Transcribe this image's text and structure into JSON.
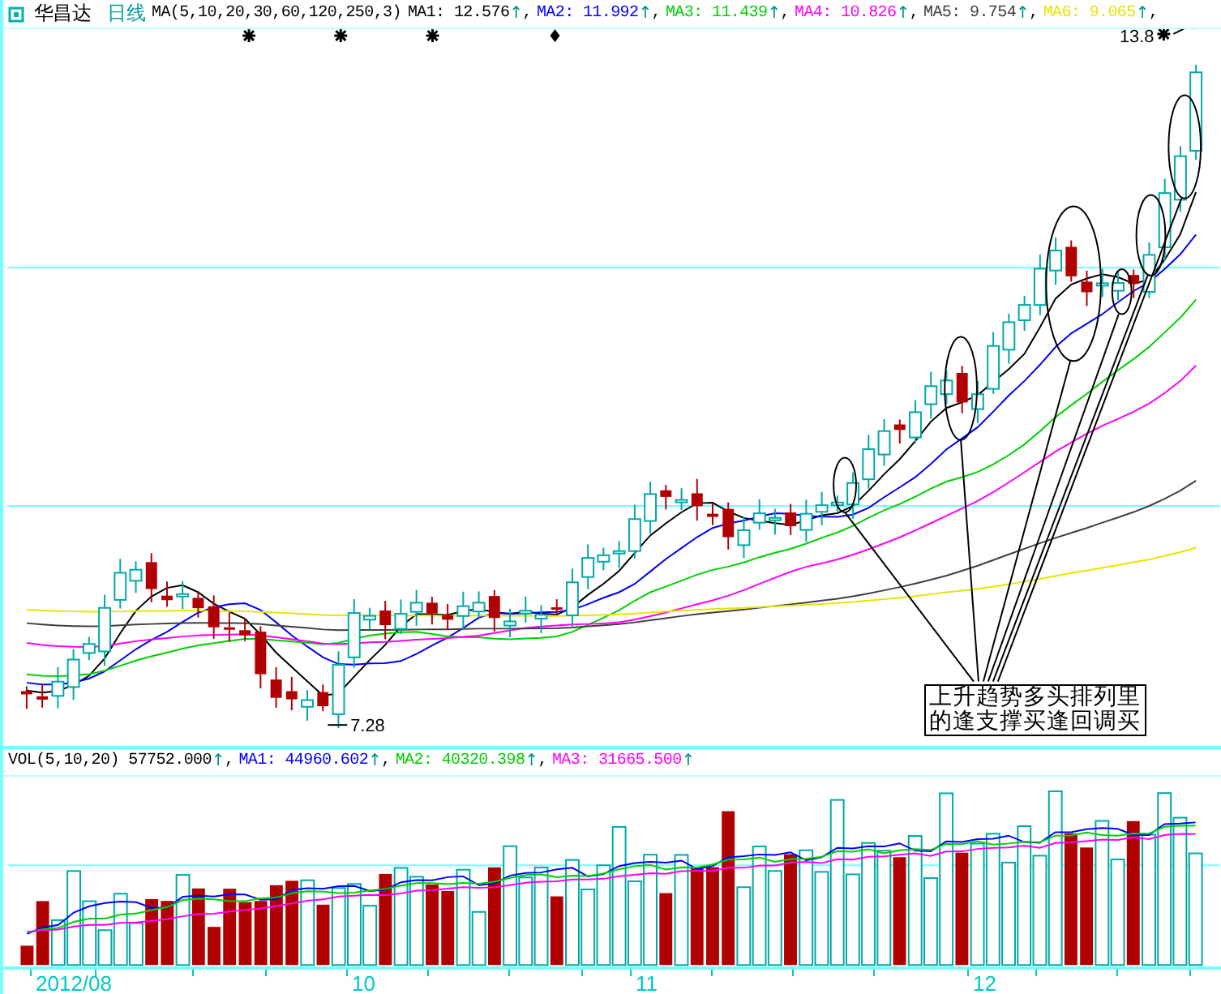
{
  "stock": {
    "name": "华昌达",
    "period": "日线",
    "indicator": "MA(5,10,20,30,60,120,250,3)"
  },
  "ma_values": [
    {
      "label": "MA1:",
      "value": "12.576",
      "arrow": "↑",
      "separator": ",",
      "color": "#000000"
    },
    {
      "label": "MA2:",
      "value": "11.992",
      "arrow": "↑",
      "separator": ",",
      "color": "#0000ff"
    },
    {
      "label": "MA3:",
      "value": "11.439",
      "arrow": "↑",
      "separator": ",",
      "color": "#00d000"
    },
    {
      "label": "MA4:",
      "value": "10.826",
      "arrow": "↑",
      "separator": ",",
      "color": "#ff00ff"
    },
    {
      "label": "MA5:",
      "value": "9.754",
      "arrow": "↑",
      "separator": ",",
      "color": "#404040"
    },
    {
      "label": "MA6:",
      "value": "9.065",
      "arrow": "↑",
      "separator": ",",
      "color": "#e6e600"
    }
  ],
  "price_labels": {
    "high": "13.8",
    "low": "7.28"
  },
  "annotation": {
    "lines": [
      "上升趋势多头排列里",
      "的逢支撑买逢回调买"
    ]
  },
  "volume": {
    "items": [
      {
        "label": "VOL(5,10,20)",
        "value": "57752.000",
        "arrow": "↑",
        "separator": ",",
        "color": "#000000"
      },
      {
        "label": "MA1:",
        "value": "44960.602",
        "arrow": "↑",
        "separator": ",",
        "color": "#0000ff"
      },
      {
        "label": "MA2:",
        "value": "40320.398",
        "arrow": "↑",
        "separator": ",",
        "color": "#00d000"
      },
      {
        "label": "MA3:",
        "value": "31665.500",
        "arrow": "↑",
        "color": "#ff00ff"
      }
    ]
  },
  "x_axis": {
    "labels": [
      "2012/08",
      "10",
      "11",
      "12"
    ]
  }
}
